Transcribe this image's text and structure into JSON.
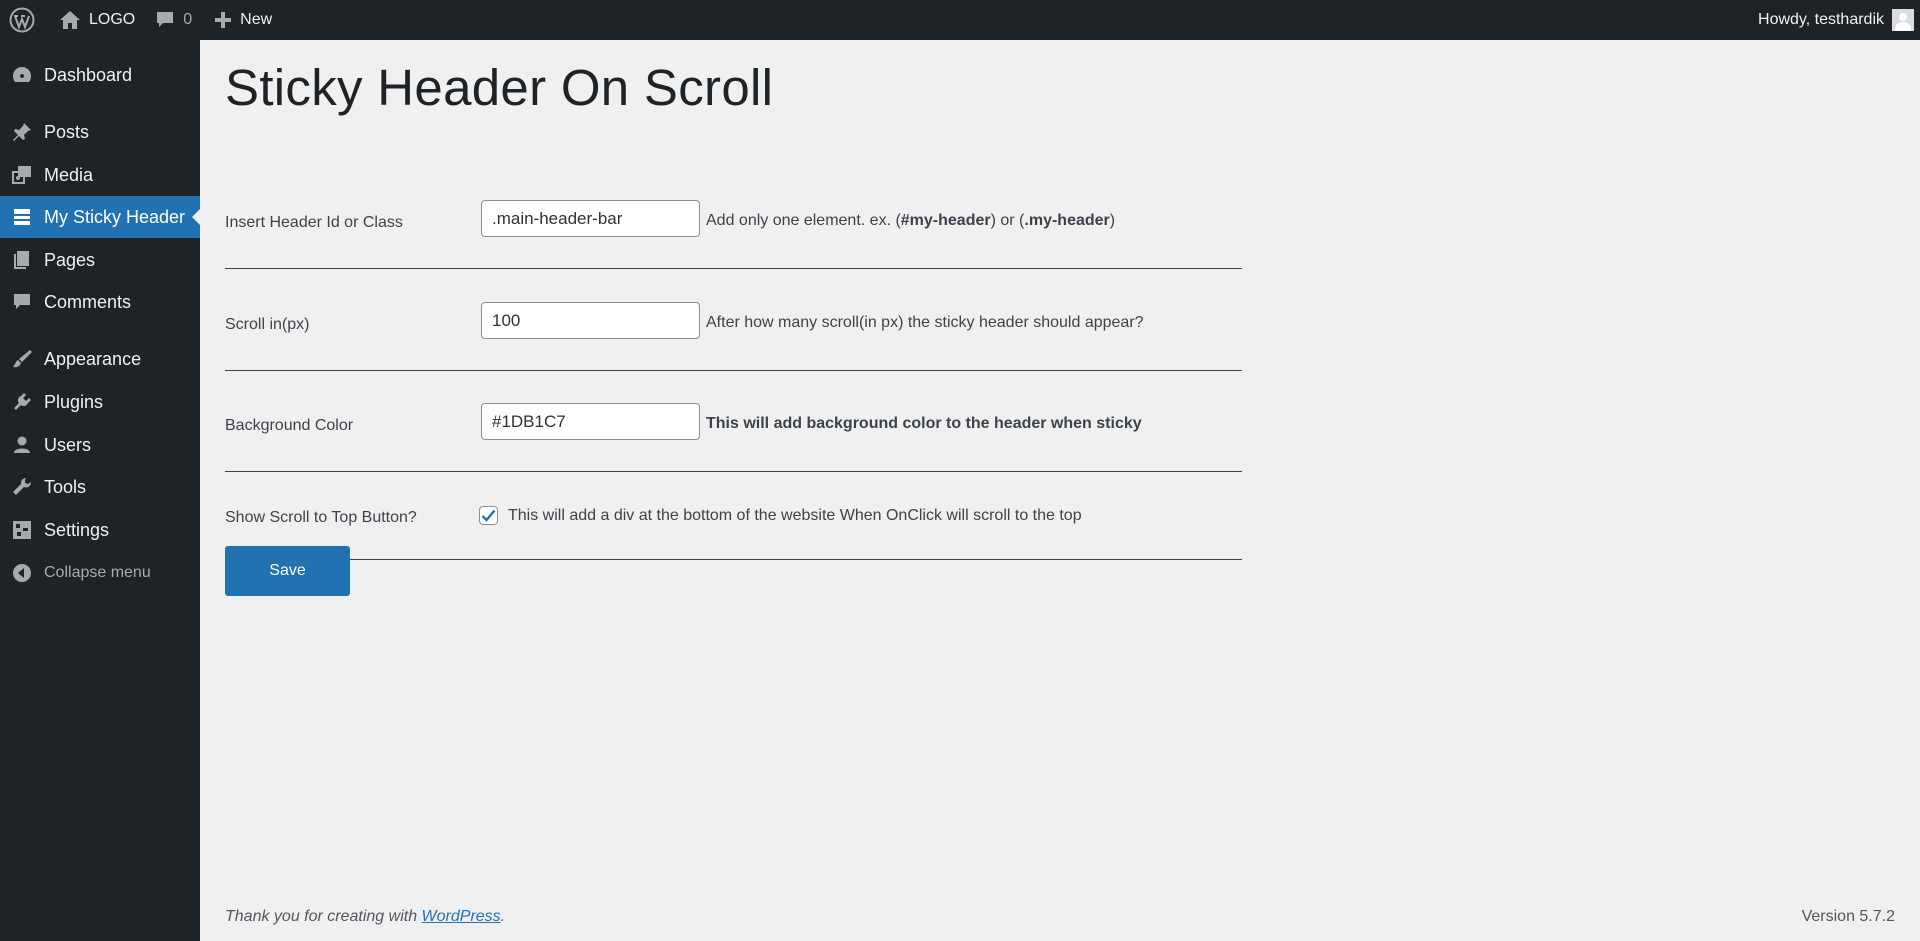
{
  "adminbar": {
    "site_name": "LOGO",
    "comments_count": "0",
    "new_label": "New",
    "howdy": "Howdy, testhardik"
  },
  "sidebar": {
    "items": [
      {
        "label": "Dashboard",
        "icon": "dashboard-icon"
      },
      {
        "label": "Posts",
        "icon": "pin-icon"
      },
      {
        "label": "Media",
        "icon": "media-icon"
      },
      {
        "label": "My Sticky Header",
        "icon": "list-icon",
        "current": true
      },
      {
        "label": "Pages",
        "icon": "pages-icon"
      },
      {
        "label": "Comments",
        "icon": "comment-icon"
      },
      {
        "label": "Appearance",
        "icon": "brush-icon"
      },
      {
        "label": "Plugins",
        "icon": "plugin-icon"
      },
      {
        "label": "Users",
        "icon": "user-icon"
      },
      {
        "label": "Tools",
        "icon": "wrench-icon"
      },
      {
        "label": "Settings",
        "icon": "settings-icon"
      }
    ],
    "collapse_label": "Collapse menu"
  },
  "page": {
    "title": "Sticky Header On Scroll"
  },
  "form": {
    "header_id": {
      "label": "Insert Header Id or Class",
      "value": ".main-header-bar",
      "desc_prefix": "Add only one element. ex. (",
      "desc_b1": "#my-header",
      "desc_mid": ") or (",
      "desc_b2": ".my-header",
      "desc_suffix": ")"
    },
    "scroll": {
      "label": "Scroll in(px)",
      "value": "100",
      "desc": "After how many scroll(in px) the sticky header should appear?"
    },
    "bg_color": {
      "label": "Background Color",
      "value": "#1DB1C7",
      "desc": "This will add background color to the header when sticky"
    },
    "scroll_top": {
      "label": "Show Scroll to Top Button?",
      "checked": true,
      "desc": "This will add a div at the bottom of the website When OnClick will scroll to the top"
    },
    "save_label": "Save"
  },
  "footer": {
    "thanks_prefix": "Thank you for creating with ",
    "wordpress_link": "WordPress",
    "thanks_suffix": ".",
    "version": "Version 5.7.2"
  },
  "colors": {
    "adminbar_bg": "#1d2327",
    "accent": "#2271b1",
    "page_bg": "#f0f0f1"
  }
}
